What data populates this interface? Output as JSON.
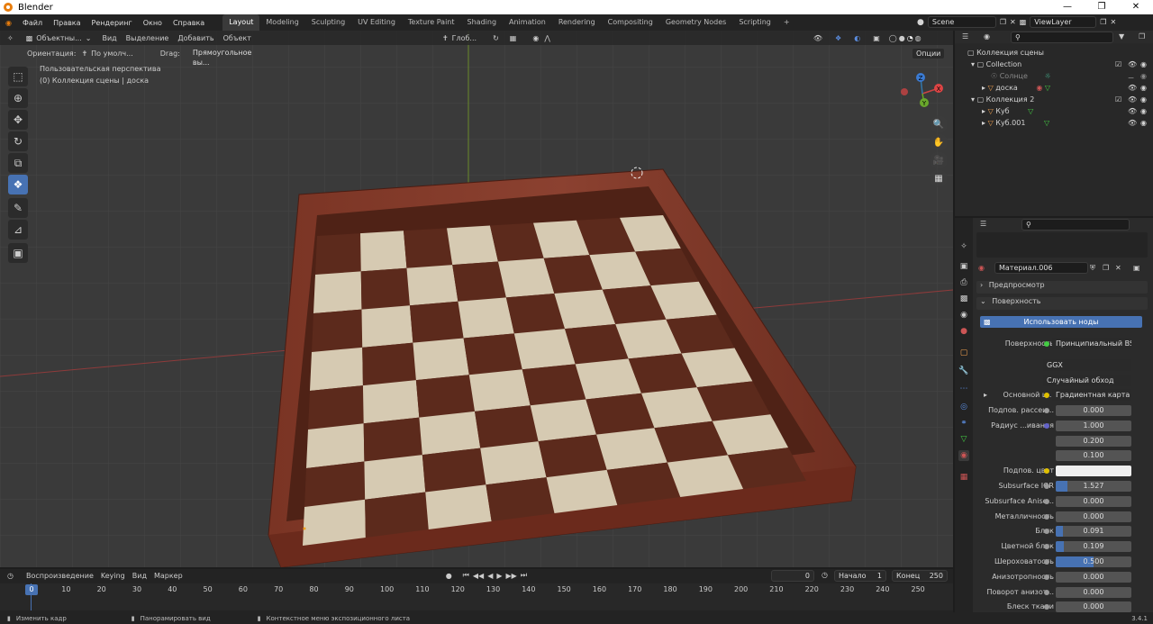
{
  "app": {
    "title": "Blender",
    "version": "3.4.1"
  },
  "menu": [
    "Файл",
    "Правка",
    "Рендеринг",
    "Окно",
    "Справка"
  ],
  "workspaces": [
    "Layout",
    "Modeling",
    "Sculpting",
    "UV Editing",
    "Texture Paint",
    "Shading",
    "Animation",
    "Rendering",
    "Compositing",
    "Geometry Nodes",
    "Scripting"
  ],
  "active_workspace": "Layout",
  "scene": {
    "name": "Scene",
    "view_layer": "ViewLayer"
  },
  "viewport": {
    "mode": "Объектны...",
    "menus": [
      "Вид",
      "Выделение",
      "Добавить",
      "Объект"
    ],
    "transform": "Глоб...",
    "orientation_label": "Ориентация:",
    "orientation_value": "По умолч...",
    "drag_label": "Drag:",
    "drag_value": "Прямоугольное вы...",
    "options": "Опции",
    "perspective_text": "Пользовательская перспектива",
    "collection_text": "(0) Коллекция сцены | доска",
    "gizmo": {
      "x": "X",
      "y": "Y",
      "z": "Z"
    }
  },
  "outliner": {
    "root": "Коллекция сцены",
    "items": [
      {
        "name": "Collection",
        "level": 1
      },
      {
        "name": "Солнце",
        "level": 2
      },
      {
        "name": "доска",
        "level": 2
      },
      {
        "name": "Коллекция 2",
        "level": 1
      },
      {
        "name": "Куб",
        "level": 2
      },
      {
        "name": "Куб.001",
        "level": 2
      }
    ]
  },
  "properties": {
    "material_name": "Материал.006",
    "panels": {
      "preview": "Предпросмотр",
      "surface": "Поверхность"
    },
    "use_nodes_button": "Использовать ноды",
    "surface_label": "Поверхность",
    "surface_value": "Принципиальный BS...",
    "distribution": "GGX",
    "subsurface_method": "Случайный обход",
    "base_color_label": "Основной ц...",
    "base_color_value": "Градиентная карта",
    "rows": [
      {
        "label": "Подпов. рассеи...",
        "value": "0.000",
        "fill": 0
      },
      {
        "label": "Радиус ...ивания",
        "value": "1.000",
        "fill": 0
      },
      {
        "label": "",
        "value": "0.200",
        "fill": 0
      },
      {
        "label": "",
        "value": "0.100",
        "fill": 0
      },
      {
        "label": "Подпов. цвет",
        "value": "",
        "fill": 0
      },
      {
        "label": "Subsurface IOR",
        "value": "1.527",
        "fill": 0.15
      },
      {
        "label": "Subsurface Aniso...",
        "value": "0.000",
        "fill": 0
      },
      {
        "label": "Металличность",
        "value": "0.000",
        "fill": 0
      },
      {
        "label": "Блик",
        "value": "0.091",
        "fill": 0.091
      },
      {
        "label": "Цветной блик",
        "value": "0.109",
        "fill": 0.109
      },
      {
        "label": "Шероховатость",
        "value": "0.500",
        "fill": 0.5
      },
      {
        "label": "Анизотропность",
        "value": "0.000",
        "fill": 0
      },
      {
        "label": "Поворот анизот...",
        "value": "0.000",
        "fill": 0
      },
      {
        "label": "Блеск ткани",
        "value": "0.000",
        "fill": 0
      }
    ]
  },
  "timeline": {
    "menus": [
      "Воспроизведение",
      "Keying",
      "Вид",
      "Маркер"
    ],
    "current_frame": "0",
    "start_label": "Начало",
    "start": "1",
    "end_label": "Конец",
    "end": "250",
    "ticks": [
      "0",
      "10",
      "20",
      "30",
      "40",
      "50",
      "60",
      "70",
      "80",
      "90",
      "100",
      "110",
      "120",
      "130",
      "140",
      "150",
      "160",
      "170",
      "180",
      "190",
      "200",
      "210",
      "220",
      "230",
      "240",
      "250"
    ]
  },
  "status": {
    "a": "Изменить кадр",
    "b": "Панорамировать вид",
    "c": "Контекстное меню экспозиционного листа"
  },
  "colors": {
    "accent": "#4772b3",
    "wood_dark": "#5a2418",
    "wood": "#8a3f2b",
    "light_square": "#d6cab2",
    "dark_square": "#5c2a1c"
  }
}
